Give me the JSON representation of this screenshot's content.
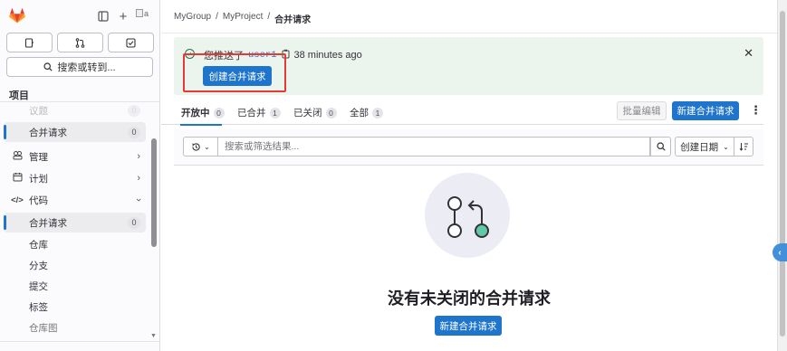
{
  "sidebar": {
    "avatar_alt": "a",
    "quick_actions": [
      {
        "name": "issues-icon"
      },
      {
        "name": "merge-requests-icon"
      },
      {
        "name": "todos-icon"
      }
    ],
    "search_label": "搜索或转到...",
    "section_title": "项目",
    "items": [
      {
        "label": "议题",
        "count": "0"
      },
      {
        "label": "合并请求",
        "count": "0"
      },
      {
        "label": "管理",
        "icon": "manage-icon"
      },
      {
        "label": "计划",
        "icon": "plan-icon"
      },
      {
        "label": "代码",
        "icon": "code-icon"
      },
      {
        "label": "合并请求",
        "count": "0"
      },
      {
        "label": "仓库"
      },
      {
        "label": "分支"
      },
      {
        "label": "提交"
      },
      {
        "label": "标签"
      },
      {
        "label": "仓库图"
      }
    ]
  },
  "breadcrumb": {
    "group": "MyGroup",
    "project": "MyProject",
    "current": "合并请求",
    "separator": "/"
  },
  "alert": {
    "prefix": "您推送了",
    "user": "user1",
    "time": "38 minutes ago",
    "button": "创建合并请求"
  },
  "tabs": [
    {
      "label": "开放中",
      "count": "0"
    },
    {
      "label": "已合并",
      "count": "1"
    },
    {
      "label": "已关闭",
      "count": "0"
    },
    {
      "label": "全部",
      "count": "1"
    }
  ],
  "toolbar": {
    "bulk_edit": "批量编辑",
    "new_mr": "新建合并请求"
  },
  "filter": {
    "placeholder": "搜索或筛选结果...",
    "sort_label": "创建日期"
  },
  "empty": {
    "title": "没有未关闭的合并请求",
    "button": "新建合并请求"
  },
  "colors": {
    "primary": "#1f75cb",
    "alert_bg": "#ecf4ee",
    "success": "#217645",
    "highlight": "#e53935",
    "illustration_teal": "#63c8a7"
  }
}
